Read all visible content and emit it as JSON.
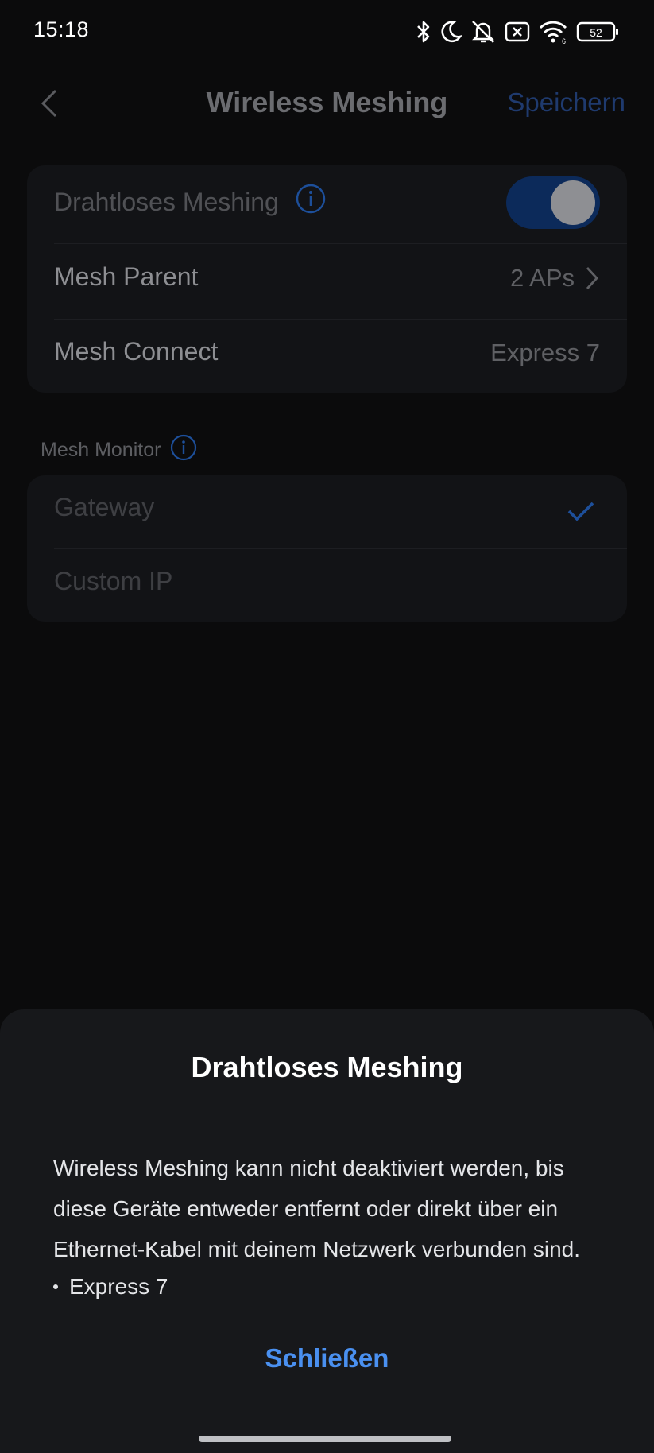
{
  "status_bar": {
    "time": "15:18",
    "battery": "52",
    "icons": [
      "bluetooth-icon",
      "moon-icon",
      "muted-bell-icon",
      "sim-off-icon",
      "wifi-icon",
      "battery-icon"
    ]
  },
  "nav": {
    "title": "Wireless Meshing",
    "save_label": "Speichern"
  },
  "settings": {
    "wireless_meshing": {
      "label": "Drahtloses Meshing",
      "enabled": true
    },
    "mesh_parent": {
      "label": "Mesh Parent",
      "value": "2 APs"
    },
    "mesh_connect": {
      "label": "Mesh Connect",
      "value": "Express 7"
    }
  },
  "mesh_monitor": {
    "header": "Mesh Monitor",
    "options": [
      {
        "label": "Gateway",
        "selected": true
      },
      {
        "label": "Custom IP",
        "selected": false
      }
    ]
  },
  "sheet": {
    "title": "Drahtloses Meshing",
    "body": "Wireless Meshing kann nicht deaktiviert werden, bis diese Geräte entweder entfernt oder direkt über ein Ethernet-Kabel mit deinem Netzwerk verbunden sind.",
    "devices": [
      "Express 7"
    ],
    "close_label": "Schließen"
  },
  "colors": {
    "accent": "#4a90f0",
    "sheet_bg": "#17181b",
    "screen_bg": "#0b0b0c"
  }
}
